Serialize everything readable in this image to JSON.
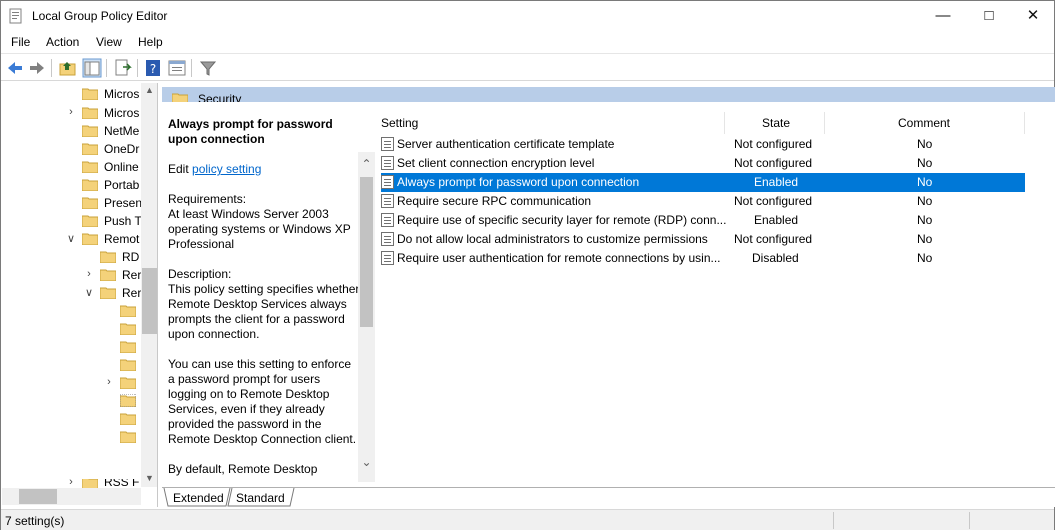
{
  "window": {
    "title": "Local Group Policy Editor",
    "minimize": "—",
    "maximize": "□",
    "close": "✕"
  },
  "menu": [
    "File",
    "Action",
    "View",
    "Help"
  ],
  "toolbar_icons": [
    "back-icon",
    "forward-icon",
    "up-folder-icon",
    "show-hide-tree-icon",
    "export-list-icon",
    "help-icon",
    "properties-icon",
    "filter-icon"
  ],
  "tree": {
    "items": [
      {
        "label": "Micros",
        "expander": ""
      },
      {
        "label": "Micros",
        "expander": "›"
      },
      {
        "label": "NetMe",
        "expander": ""
      },
      {
        "label": "OneDr",
        "expander": ""
      },
      {
        "label": "Online",
        "expander": ""
      },
      {
        "label": "Portab",
        "expander": ""
      },
      {
        "label": "Presen",
        "expander": ""
      },
      {
        "label": "Push T",
        "expander": ""
      },
      {
        "label": "Remot",
        "expander": "∨"
      },
      {
        "label": "RD",
        "expander": ""
      },
      {
        "label": "Rer",
        "expander": "›"
      },
      {
        "label": "Rer",
        "expander": "∨"
      },
      {
        "label": "",
        "expander": ""
      },
      {
        "label": "",
        "expander": ""
      },
      {
        "label": "",
        "expander": ""
      },
      {
        "label": "",
        "expander": ""
      },
      {
        "label": "",
        "expander": "›"
      },
      {
        "label": "",
        "expander": ""
      },
      {
        "label": "",
        "expander": ""
      },
      {
        "label": "RSS F",
        "expander": "›"
      }
    ]
  },
  "panel": {
    "title": "Security",
    "description": {
      "setting_title": "Always prompt for password upon connection",
      "edit_prefix": "Edit ",
      "edit_link": "policy setting",
      "requirements_label": "Requirements:",
      "requirements": "At least Windows Server 2003 operating systems or Windows XP Professional",
      "description_label": "Description:",
      "description": "This policy setting specifies whether Remote Desktop Services always prompts the client for a password upon connection.",
      "detail": "You can use this setting to enforce a password prompt for users logging on to Remote Desktop Services, even if they already provided the password in the Remote Desktop Connection client.",
      "more": "By default, Remote Desktop"
    },
    "columns": {
      "setting": "Setting",
      "state": "State",
      "comment": "Comment"
    },
    "rows": [
      {
        "setting": "Server authentication certificate template",
        "state": "Not configured",
        "comment": "No"
      },
      {
        "setting": "Set client connection encryption level",
        "state": "Not configured",
        "comment": "No"
      },
      {
        "setting": "Always prompt for password upon connection",
        "state": "Enabled",
        "comment": "No"
      },
      {
        "setting": "Require secure RPC communication",
        "state": "Not configured",
        "comment": "No"
      },
      {
        "setting": "Require use of specific security layer for remote (RDP) conn...",
        "state": "Enabled",
        "comment": "No"
      },
      {
        "setting": "Do not allow local administrators to customize permissions",
        "state": "Not configured",
        "comment": "No"
      },
      {
        "setting": "Require user authentication for remote connections by usin...",
        "state": "Disabled",
        "comment": "No"
      }
    ],
    "selected_row": 2
  },
  "tabs": [
    "Extended",
    "Standard"
  ],
  "status": "7 setting(s)",
  "colors": {
    "selection": "#0078d7",
    "header": "#b8cde8",
    "folder": "#f4d27a",
    "link": "#0066cc"
  }
}
